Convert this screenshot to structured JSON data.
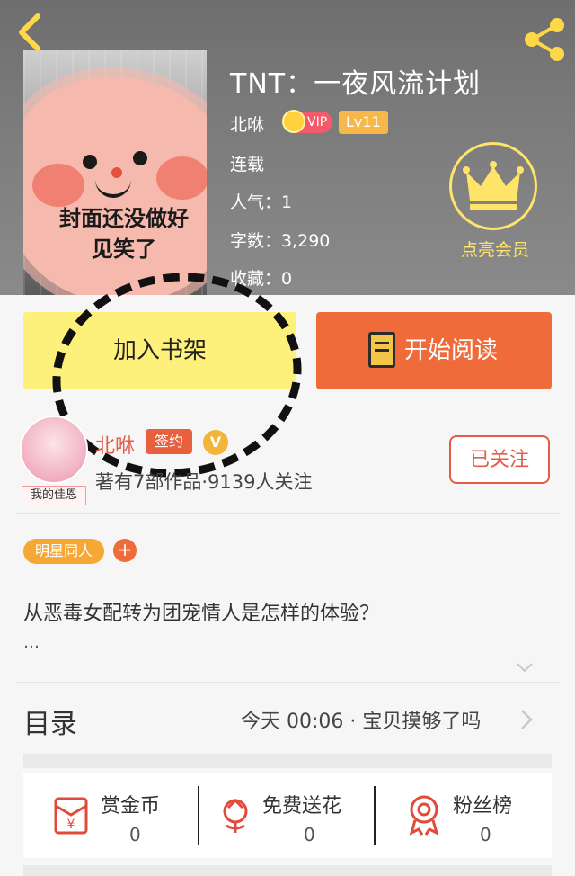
{
  "header": {
    "title": "TNT：一夜风流计划",
    "author": "北咻",
    "vip_badge": "VIP",
    "level_badge": "Lv11",
    "status": "连载",
    "popularity": "人气：1",
    "word_count": "字数：3,290",
    "favorites": "收藏：0",
    "cover_text_line1": "封面还没做好",
    "cover_text_line2": "见笑了",
    "vip_action": "点亮会员"
  },
  "buttons": {
    "add_shelf": "加入书架",
    "start_read": "开始阅读"
  },
  "author": {
    "name": "北咻",
    "sign_badge": "签约",
    "verified_badge": "V",
    "stats": "著有7部作品·9139人关注",
    "avatar_tag": "我的佳恩",
    "follow_label": "已关注"
  },
  "tags": {
    "category": "明星同人",
    "add": "+"
  },
  "summary": {
    "text": "从恶毒女配转为团宠情人是怎样的体验？",
    "ellipsis": "…"
  },
  "catalog": {
    "label": "目录",
    "latest": "今天 00:06 · 宝贝摸够了吗"
  },
  "actions": [
    {
      "label": "赏金币",
      "count": "0",
      "icon": "coin-envelope-icon"
    },
    {
      "label": "免费送花",
      "count": "0",
      "icon": "flower-icon"
    },
    {
      "label": "粉丝榜",
      "count": "0",
      "icon": "medal-icon"
    }
  ],
  "colors": {
    "accent_orange": "#f06b3a",
    "shelf_yellow": "#fef17b",
    "vip_gold": "#ffe46a"
  }
}
